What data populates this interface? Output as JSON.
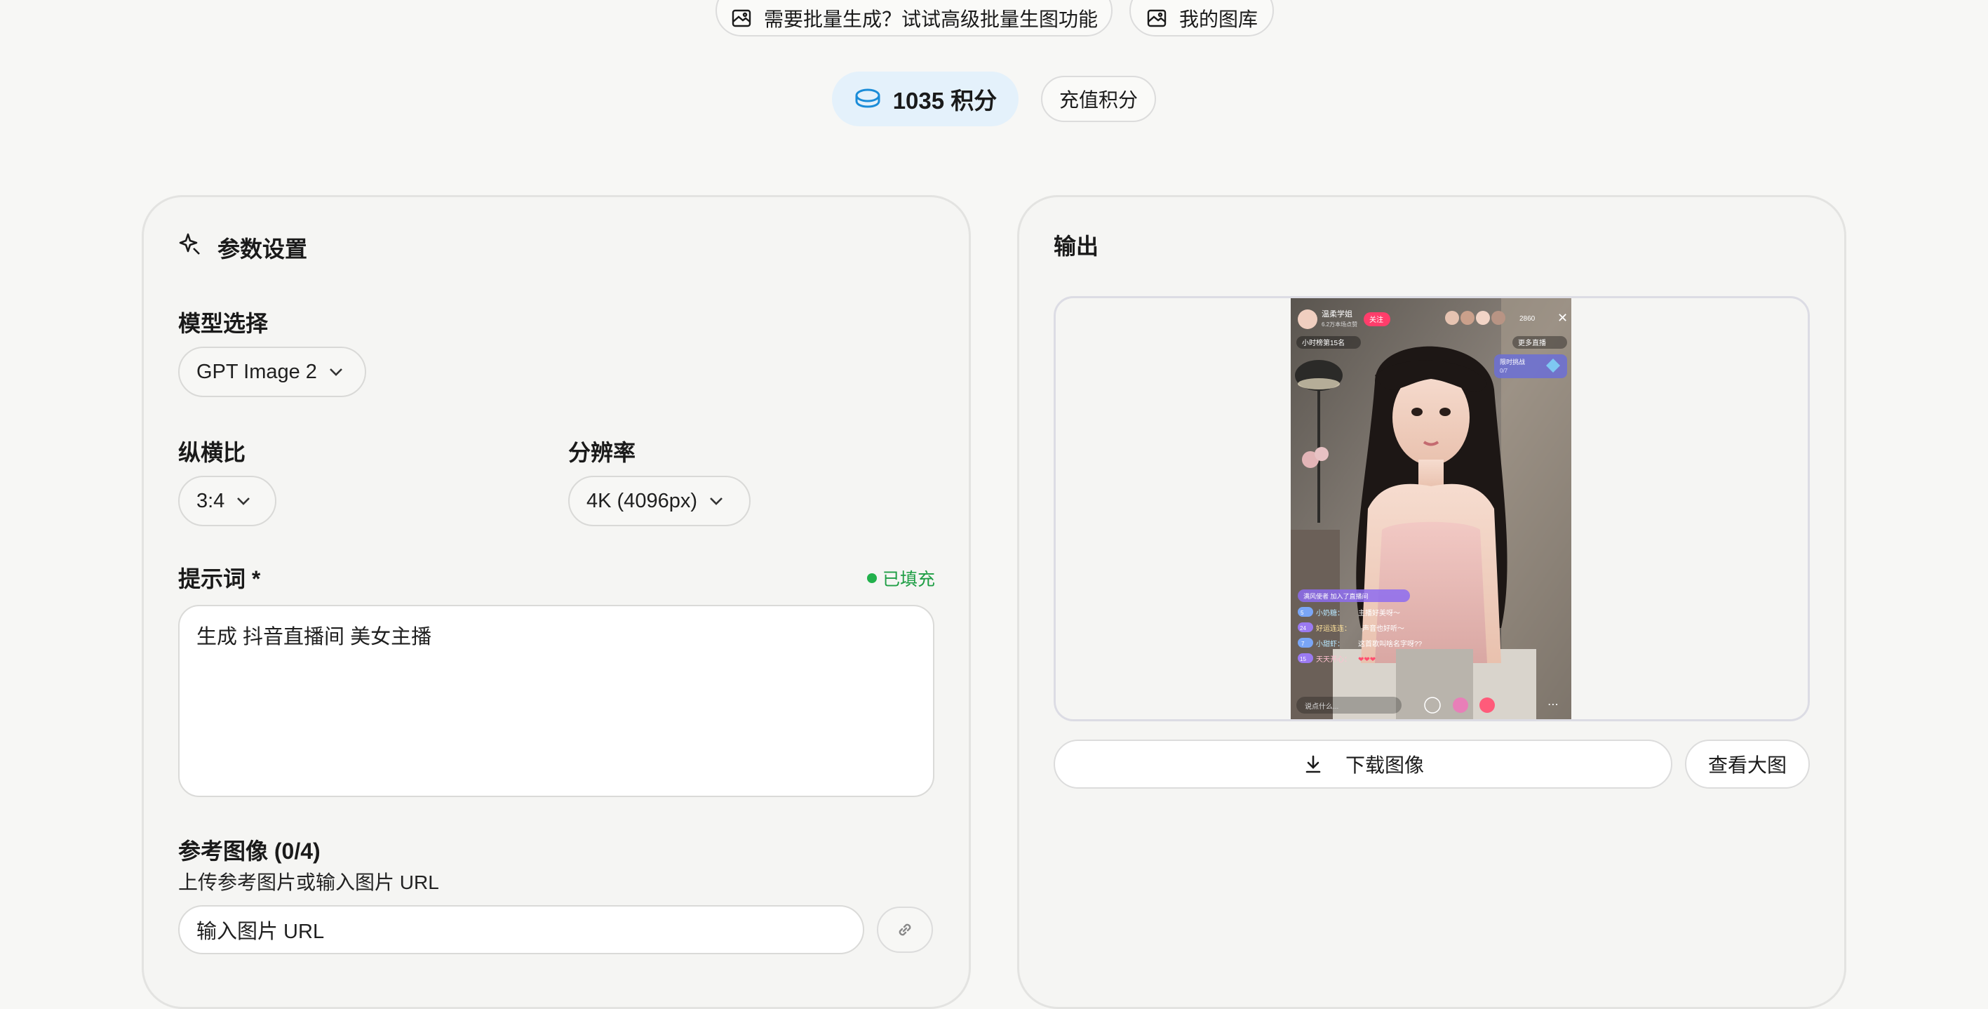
{
  "top_nav": {
    "batch_button": "需要批量生成？试试高级批量生图功能",
    "gallery_button": "我的图库"
  },
  "credits": {
    "amount": "1035 积分",
    "recharge_label": "充值积分"
  },
  "params_panel": {
    "title": "参数设置",
    "model_label": "模型选择",
    "model_value": "GPT Image 2",
    "aspect_label": "纵横比",
    "aspect_value": "3:4",
    "resolution_label": "分辨率",
    "resolution_value": "4K (4096px)",
    "prompt_label": "提示词 *",
    "prompt_status": "已填充",
    "prompt_value": "生成 抖音直播间 美女主播",
    "reference_label": "参考图像 (0/4)",
    "reference_hint": "上传参考图片或输入图片 URL",
    "url_placeholder": "输入图片 URL"
  },
  "output_panel": {
    "title": "输出",
    "download_label": "下载图像",
    "view_large_label": "查看大图"
  },
  "output_image": {
    "streamer_name": "温柔学姐",
    "streamer_sub": "6.2万本场点赞",
    "follow_label": "关注",
    "viewer_count": "2860",
    "hour_rank": "小时榜第15名",
    "more_live": "更多直播",
    "challenge_title": "限时挑战",
    "challenge_progress": "0/7",
    "join_notice": "满风使者 加入了直播间",
    "comments": [
      {
        "badge": "5",
        "user": "小奶糖：",
        "text": "主播好美呀～"
      },
      {
        "badge": "24",
        "user": "好运连连：",
        "text": "声音也好听～"
      },
      {
        "badge": "7",
        "user": "小甜虾：",
        "text": "这首歌叫啥名字呀??"
      },
      {
        "badge": "15",
        "user": "天天开心：",
        "text": "❤❤❤"
      }
    ],
    "input_placeholder": "说点什么..."
  },
  "colors": {
    "accent_blue": "#1a8cd8",
    "status_green": "#22b14c",
    "pink": "#ff3d6b"
  }
}
